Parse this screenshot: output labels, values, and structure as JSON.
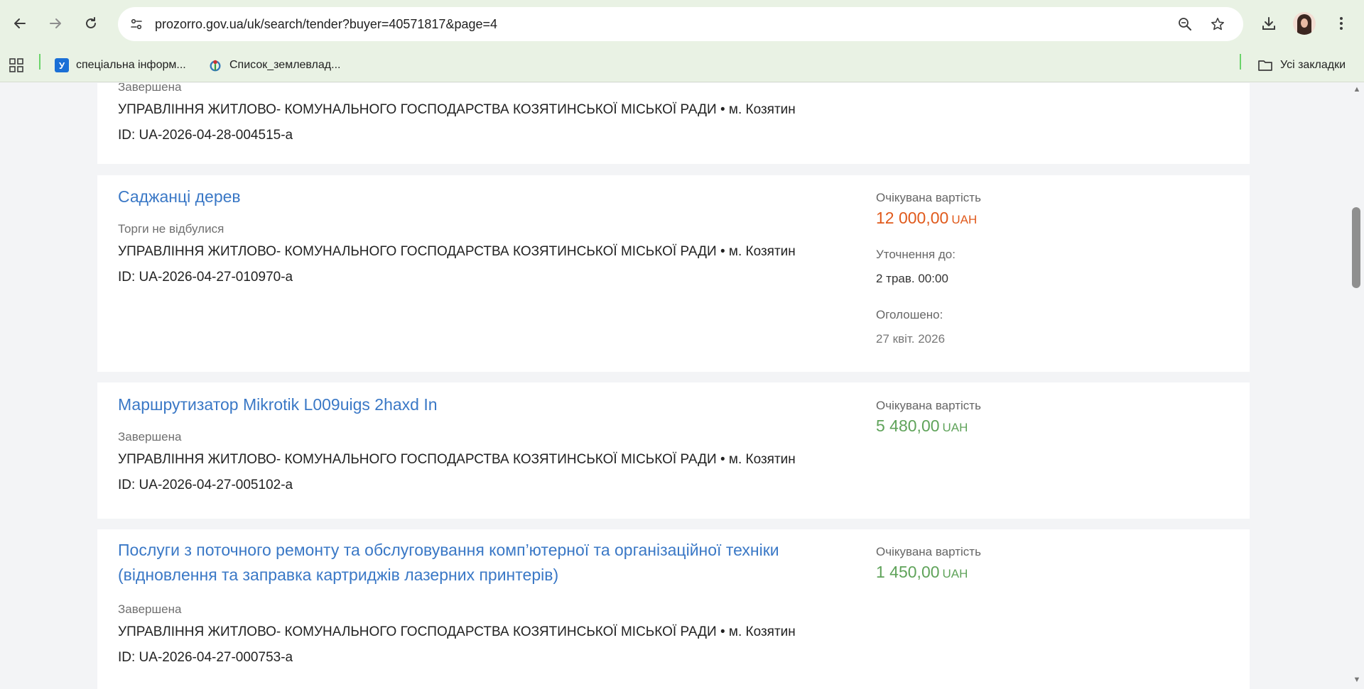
{
  "browser": {
    "url": "prozorro.gov.ua/uk/search/tender?buyer=40571817&page=4",
    "bookmarks": [
      {
        "label": "спеціальна інформ...",
        "icon_letter": "У"
      },
      {
        "label": "Список_землевлад..."
      }
    ],
    "all_bookmarks_label": "Усі закладки"
  },
  "tenders": [
    {
      "status": "Завершена",
      "organization": "УПРАВЛІННЯ ЖИТЛОВО- КОМУНАЛЬНОГО ГОСПОДАРСТВА КОЗЯТИНСЬКОЇ МІСЬКОЇ РАДИ • м. Козятин",
      "id": "ID: UA-2026-04-28-004515-a"
    },
    {
      "title": "Саджанці дерев",
      "status": "Торги не відбулися",
      "organization": "УПРАВЛІННЯ ЖИТЛОВО- КОМУНАЛЬНОГО ГОСПОДАРСТВА КОЗЯТИНСЬКОЇ МІСЬКОЇ РАДИ • м. Козятин",
      "id": "ID: UA-2026-04-27-010970-a",
      "expected_label": "Очікувана вартість",
      "amount": "12 000,00",
      "currency": "UAH",
      "amount_color": "#e05a1c",
      "clarification_label": "Уточнення до:",
      "clarification_value": "2 трав. 00:00",
      "announced_label": "Оголошено:",
      "announced_value": "27 квіт. 2026"
    },
    {
      "title": "Маршрутизатор Mikrotik L009uigs 2haxd In",
      "status": "Завершена",
      "organization": "УПРАВЛІННЯ ЖИТЛОВО- КОМУНАЛЬНОГО ГОСПОДАРСТВА КОЗЯТИНСЬКОЇ МІСЬКОЇ РАДИ • м. Козятин",
      "id": "ID: UA-2026-04-27-005102-a",
      "expected_label": "Очікувана вартість",
      "amount": "5 480,00",
      "currency": "UAH",
      "amount_color": "#5fa35a"
    },
    {
      "title_line1": "Послуги з поточного ремонту та обслуговування комп’ютерної та організаційної техніки",
      "title_line2": "(відновлення та заправка картриджів лазерних принтерів)",
      "status": "Завершена",
      "organization": "УПРАВЛІННЯ ЖИТЛОВО- КОМУНАЛЬНОГО ГОСПОДАРСТВА КОЗЯТИНСЬКОЇ МІСЬКОЇ РАДИ • м. Козятин",
      "id": "ID: UA-2026-04-27-000753-a",
      "expected_label": "Очікувана вартість",
      "amount": "1 450,00",
      "currency": "UAH",
      "amount_color": "#5fa35a"
    }
  ],
  "colors": {
    "link": "#3a78c6",
    "chrome_bg": "#e9f2e4",
    "page_bg": "#f3f4f6"
  }
}
